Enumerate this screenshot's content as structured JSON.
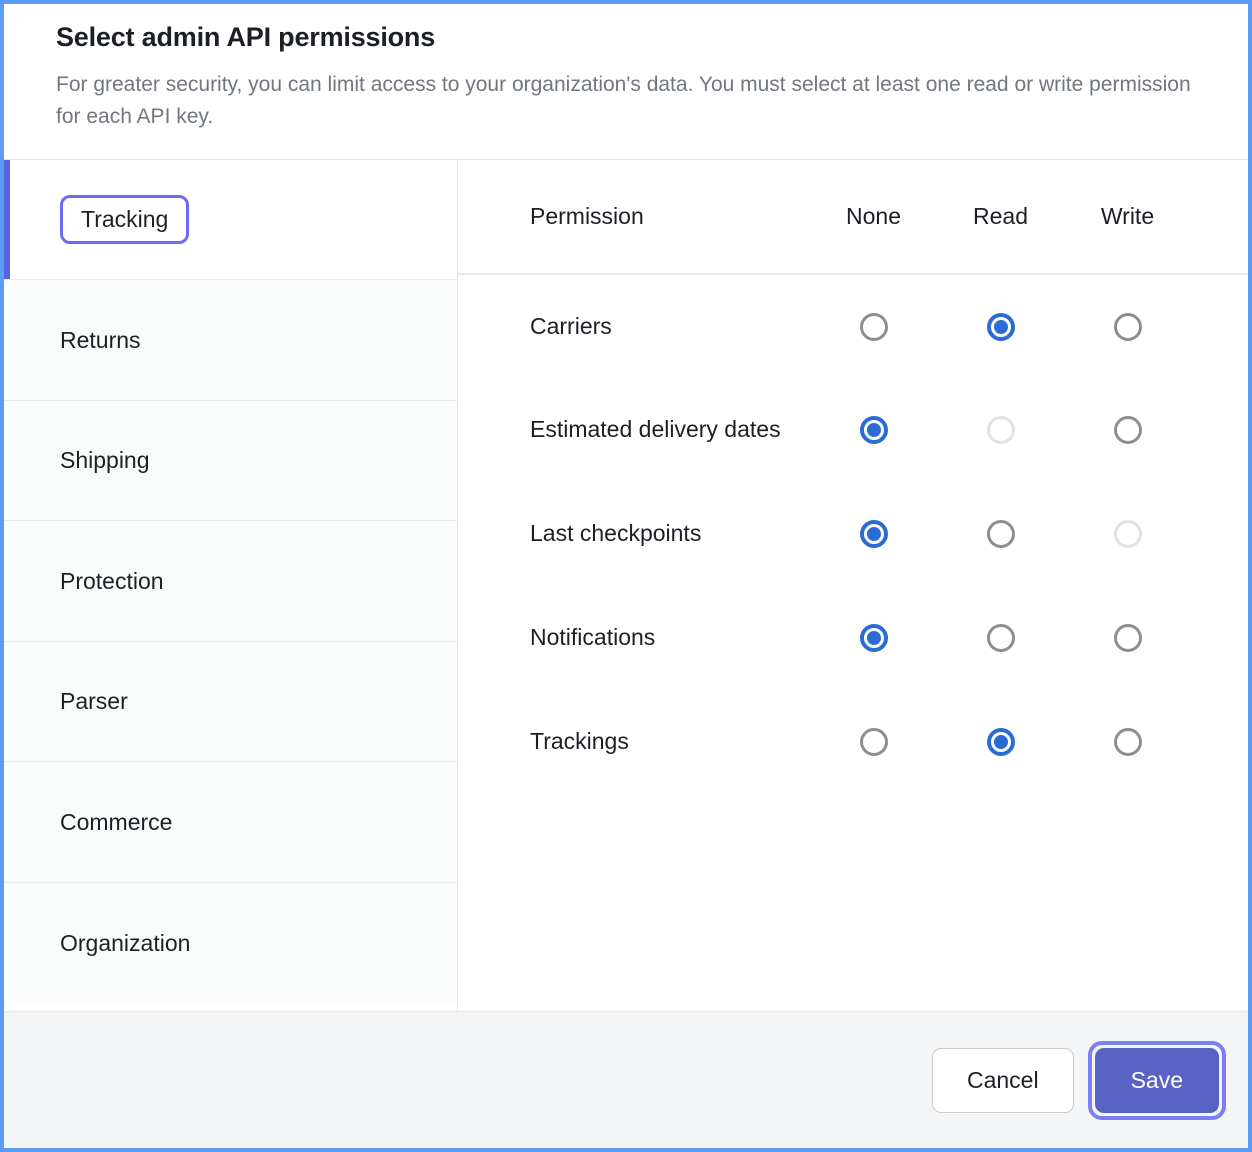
{
  "dialog": {
    "title": "Select admin API permissions",
    "subtitle": "For greater security, you can limit access to your organization's data. You must select at least one read or write permission for each API key."
  },
  "sidebar": {
    "items": [
      {
        "label": "Tracking",
        "active": true
      },
      {
        "label": "Returns",
        "active": false
      },
      {
        "label": "Shipping",
        "active": false
      },
      {
        "label": "Protection",
        "active": false
      },
      {
        "label": "Parser",
        "active": false
      },
      {
        "label": "Commerce",
        "active": false
      },
      {
        "label": "Organization",
        "active": false
      }
    ]
  },
  "table": {
    "headers": {
      "permission": "Permission",
      "none": "None",
      "read": "Read",
      "write": "Write"
    },
    "rows": [
      {
        "label": "Carriers",
        "none": "unchecked",
        "read": "checked",
        "write": "unchecked"
      },
      {
        "label": "Estimated delivery dates",
        "none": "checked",
        "read": "disabled",
        "write": "unchecked"
      },
      {
        "label": "Last checkpoints",
        "none": "checked",
        "read": "unchecked",
        "write": "disabled"
      },
      {
        "label": "Notifications",
        "none": "checked",
        "read": "unchecked",
        "write": "unchecked"
      },
      {
        "label": "Trackings",
        "none": "unchecked",
        "read": "checked",
        "write": "unchecked"
      }
    ]
  },
  "footer": {
    "cancel_label": "Cancel",
    "save_label": "Save"
  },
  "colors": {
    "page_focus_border": "#5a9cf8",
    "accent_purple": "#6b6bf5",
    "active_indicator": "#5a63d8",
    "save_button": "#5a63c4",
    "save_focus_ring": "#7b7ff5",
    "radio_selected": "#2b6cd4",
    "radio_border": "#8a8f94",
    "radio_disabled": "#e0e3e6",
    "subtitle_text": "#72777d",
    "footer_background": "#f4f5f6",
    "sidebar_item_background": "#fafbfb"
  }
}
